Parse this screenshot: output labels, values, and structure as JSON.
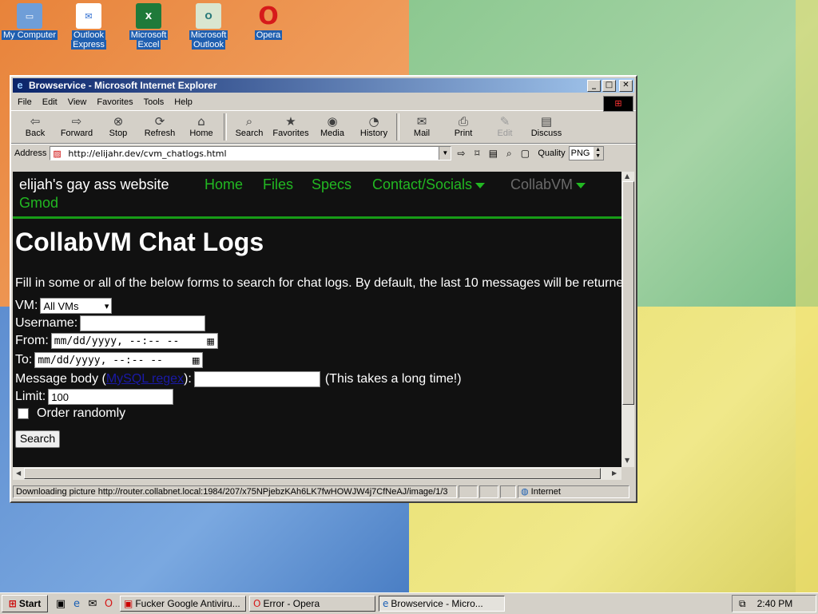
{
  "desktop": {
    "icons": [
      {
        "label_1": "My Computer",
        "label_2": "",
        "glyph": "🖳",
        "color": "#3a6ea5"
      },
      {
        "label_1": "Outlook",
        "label_2": "Express",
        "glyph": "✉",
        "color": "#2a6ad0"
      },
      {
        "label_1": "Microsoft",
        "label_2": "Excel",
        "glyph": "X",
        "color": "#1f7a3a"
      },
      {
        "label_1": "Microsoft",
        "label_2": "Outlook",
        "glyph": "O",
        "color": "#2a7a7a"
      },
      {
        "label_1": "Opera",
        "label_2": "",
        "glyph": "O",
        "color": "#d61a1a"
      }
    ]
  },
  "window": {
    "title": "Browservice - Microsoft Internet Explorer",
    "controls": {
      "min": "_",
      "max": "□",
      "close": "✕"
    },
    "menu": [
      "File",
      "Edit",
      "View",
      "Favorites",
      "Tools",
      "Help"
    ],
    "toolbar": [
      {
        "label": "Back",
        "glyph": "⇦"
      },
      {
        "label": "Forward",
        "glyph": "⇨"
      },
      {
        "label": "Stop",
        "glyph": "⊗"
      },
      {
        "label": "Refresh",
        "glyph": "⟳"
      },
      {
        "label": "Home",
        "glyph": "⌂"
      },
      {
        "label": "Search",
        "glyph": "⌕"
      },
      {
        "label": "Favorites",
        "glyph": "★"
      },
      {
        "label": "Media",
        "glyph": "◉"
      },
      {
        "label": "History",
        "glyph": "◔"
      },
      {
        "label": "Mail",
        "glyph": "✉"
      },
      {
        "label": "Print",
        "glyph": "⎙"
      },
      {
        "label": "Edit",
        "glyph": "✎"
      },
      {
        "label": "Discuss",
        "glyph": "▤"
      }
    ],
    "address": {
      "label": "Address",
      "url": "http://elijahr.dev/cvm_chatlogs.html"
    },
    "quality": {
      "label": "Quality",
      "value": "PNG"
    },
    "status": {
      "message": "Downloading picture http://router.collabnet.local:1984/207/x75NPjebzKAh6LK7fwHOWJW4j7CfNeAJ/image/1/3",
      "zone": "Internet"
    }
  },
  "site": {
    "brand": "elijah's gay ass website",
    "nav": [
      "Home",
      "Files",
      "Specs",
      "Contact/Socials",
      "CollabVM",
      "Gmod"
    ],
    "heading": "CollabVM Chat Logs",
    "intro": "Fill in some or all of the below forms to search for chat logs. By default, the last 10 messages will be returned",
    "form": {
      "vm_label": "VM:",
      "vm_value": "All VMs",
      "username_label": "Username:",
      "username_value": "",
      "from_label": "From:",
      "from_placeholder": "mm/dd/yyyy, --:-- --",
      "to_label": "To:",
      "to_placeholder": "mm/dd/yyyy, --:-- --",
      "body_label_pre": "Message body (",
      "body_link": "MySQL regex",
      "body_label_post": "):",
      "body_value": "",
      "body_note": "(This takes a long time!)",
      "limit_label": "Limit:",
      "limit_value": "100",
      "random_label": "Order randomly",
      "search_button": "Search"
    }
  },
  "taskbar": {
    "start": "Start",
    "tasks": [
      {
        "label": "Fucker Google Antiviru...",
        "glyph": "▣"
      },
      {
        "label": "Error - Opera",
        "glyph": "O"
      },
      {
        "label": "Browservice - Micro...",
        "glyph": "e"
      }
    ],
    "clock": "2:40 PM"
  }
}
